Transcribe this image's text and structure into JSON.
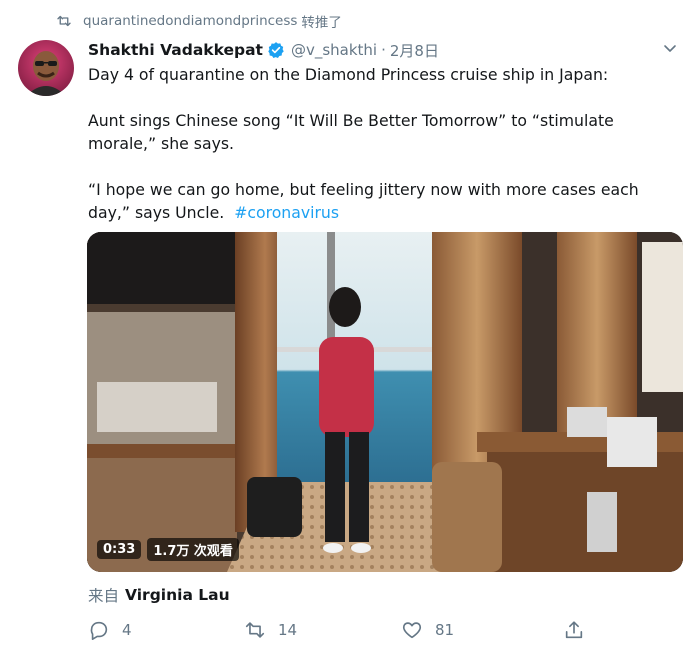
{
  "retweet": {
    "user": "quarantinedondiamondprincess",
    "action": "转推了",
    "icon": "retweet-icon"
  },
  "tweet": {
    "author_name": "Shakthi Vadakkepat",
    "verified": true,
    "handle": "@v_shakthi",
    "separator": "·",
    "date": "2月8日",
    "lines": [
      "Day 4 of quarantine on the Diamond Princess cruise ship in Japan:",
      "Aunt sings Chinese song “It Will Be Better Tomorrow” to “stimulate",
      "morale,” she says.",
      "“I hope we can go home, but feeling jittery now with more cases each",
      "day,” says Uncle."
    ],
    "hashtag": "#coronavirus"
  },
  "video": {
    "duration": "0:33",
    "views": "1.7万 次观看"
  },
  "attribution": {
    "prefix": "来自",
    "user": "Virginia Lau"
  },
  "actions": {
    "reply_count": "4",
    "retweet_count": "14",
    "like_count": "81"
  },
  "colors": {
    "text": "#14171a",
    "secondary": "#657786",
    "accent": "#1da1f2"
  }
}
